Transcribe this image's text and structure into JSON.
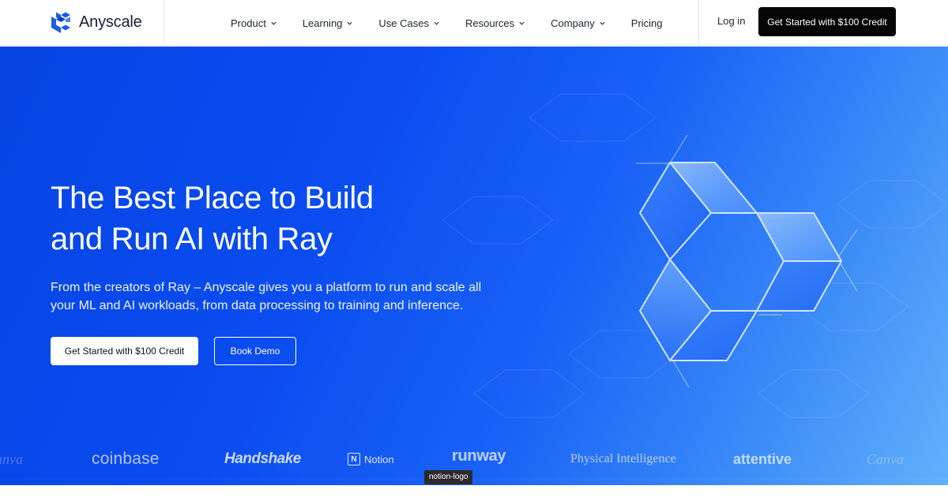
{
  "header": {
    "brand": "Anyscale",
    "nav": [
      {
        "label": "Product",
        "dropdown": true
      },
      {
        "label": "Learning",
        "dropdown": true
      },
      {
        "label": "Use Cases",
        "dropdown": true
      },
      {
        "label": "Resources",
        "dropdown": true
      },
      {
        "label": "Company",
        "dropdown": true
      },
      {
        "label": "Pricing",
        "dropdown": false
      }
    ],
    "login_label": "Log in",
    "cta_label": "Get Started with $100 Credit"
  },
  "hero": {
    "headline_line1": "The Best Place to Build",
    "headline_line2": "and Run AI with Ray",
    "subtitle": "From the creators of Ray – Anyscale gives you a platform to run and scale all your ML and AI workloads, from data processing to training and inference.",
    "primary_cta": "Get Started with $100 Credit",
    "secondary_cta": "Book Demo"
  },
  "customer_logos": {
    "left_partial": "canva",
    "coinbase": "coinbase",
    "handshake": "Handshake",
    "notion": "Notion",
    "notion_icon_letter": "N",
    "runway": "runway",
    "physical_intelligence": "Physical Intelligence",
    "attentive": "attentive",
    "canva": "Canva"
  },
  "tooltip": "notion-logo",
  "colors": {
    "hero_start": "#0644e3",
    "hero_end": "#62b0fb",
    "cta_dark": "#050505",
    "brand_text": "#1a1f36"
  },
  "icons": {
    "logo": "anyscale-logo-icon",
    "chevron": "chevron-down-icon"
  }
}
